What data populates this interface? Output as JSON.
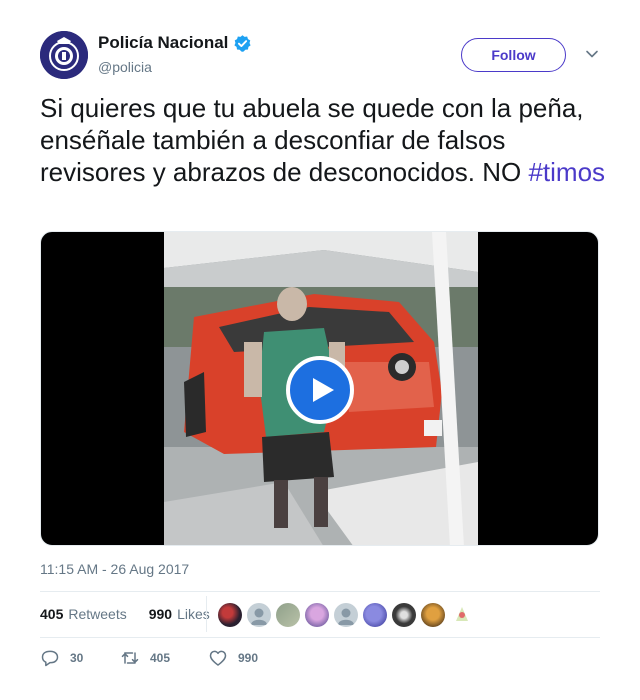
{
  "author": {
    "display_name": "Policía Nacional",
    "handle": "@policia",
    "avatar_icon": "police-crest-icon",
    "verified_icon": "verified-badge-icon"
  },
  "follow_label": "Follow",
  "tweet": {
    "text_main": "Si quieres que tu abuela se quede con la peña, enséñale también a desconfiar de falsos revisores y abrazos de desconocidos. NO ",
    "hashtag": "#timos"
  },
  "media": {
    "play_icon": "play-icon"
  },
  "timestamp": "11:15 AM - 26 Aug 2017",
  "stats": {
    "retweets_count": "405",
    "retweets_label": "Retweets",
    "likes_count": "990",
    "likes_label": "Likes"
  },
  "actions": {
    "reply_count": "30",
    "retweet_count": "405",
    "like_count": "990"
  },
  "colors": {
    "accent": "#4b3ac9",
    "verified": "#1da1f2",
    "play": "#1d6fe0",
    "muted": "#657786"
  }
}
